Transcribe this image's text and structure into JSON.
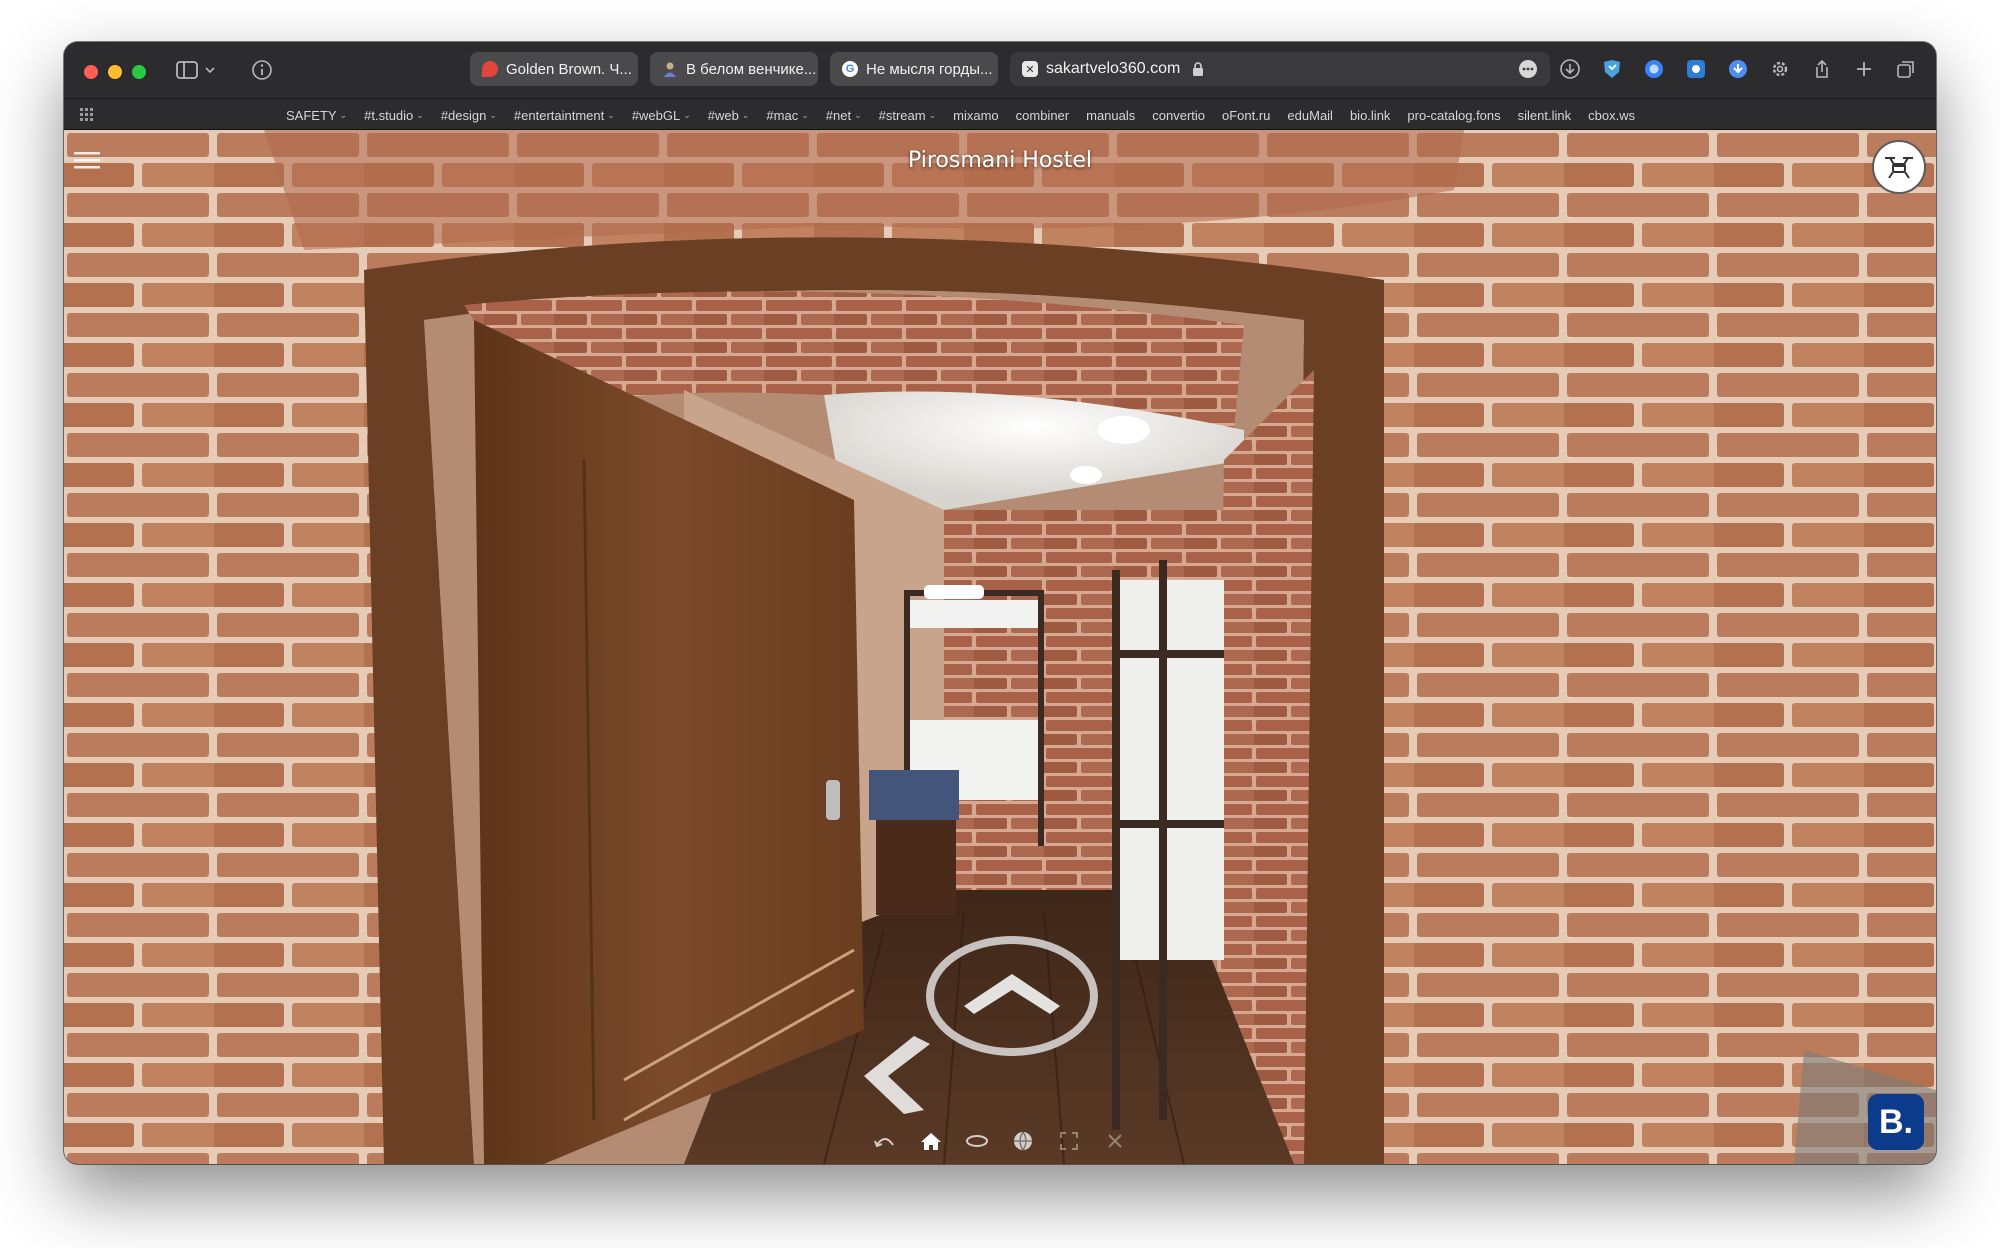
{
  "browser": {
    "tabs": [
      {
        "label": "Golden Brown. Ч...",
        "favicon": "speech-bubble-icon",
        "favicon_color": "#e0463b"
      },
      {
        "label": "В белом венчике...",
        "favicon": "person-icon",
        "favicon_color": "#6b7dd6"
      },
      {
        "label": "Не мысля горды...",
        "favicon": "google-icon",
        "favicon_color": "#ffffff"
      }
    ],
    "url": "sakartvelo360.com",
    "bookmarks": [
      {
        "label": "SAFETY",
        "folder": true
      },
      {
        "label": "#t.studio",
        "folder": true
      },
      {
        "label": "#design",
        "folder": true
      },
      {
        "label": "#entertaintment",
        "folder": true
      },
      {
        "label": "#webGL",
        "folder": true
      },
      {
        "label": "#web",
        "folder": true
      },
      {
        "label": "#mac",
        "folder": true
      },
      {
        "label": "#net",
        "folder": true
      },
      {
        "label": "#stream",
        "folder": true
      },
      {
        "label": "mixamo",
        "folder": false
      },
      {
        "label": "combiner",
        "folder": false
      },
      {
        "label": "manuals",
        "folder": false
      },
      {
        "label": "convertio",
        "folder": false
      },
      {
        "label": "oFont.ru",
        "folder": false
      },
      {
        "label": "eduMail",
        "folder": false
      },
      {
        "label": "bio.link",
        "folder": false
      },
      {
        "label": "pro-catalog.fons",
        "folder": false
      },
      {
        "label": "silent.link",
        "folder": false
      },
      {
        "label": "cbox.ws",
        "folder": false
      }
    ]
  },
  "viewer": {
    "title": "Pirosmani Hostel",
    "booking_label": "B.",
    "colors": {
      "brick": "#b9785a",
      "mortar": "#e3c9b5",
      "door": "#6b3e22",
      "floor": "#4a2e1f"
    }
  }
}
